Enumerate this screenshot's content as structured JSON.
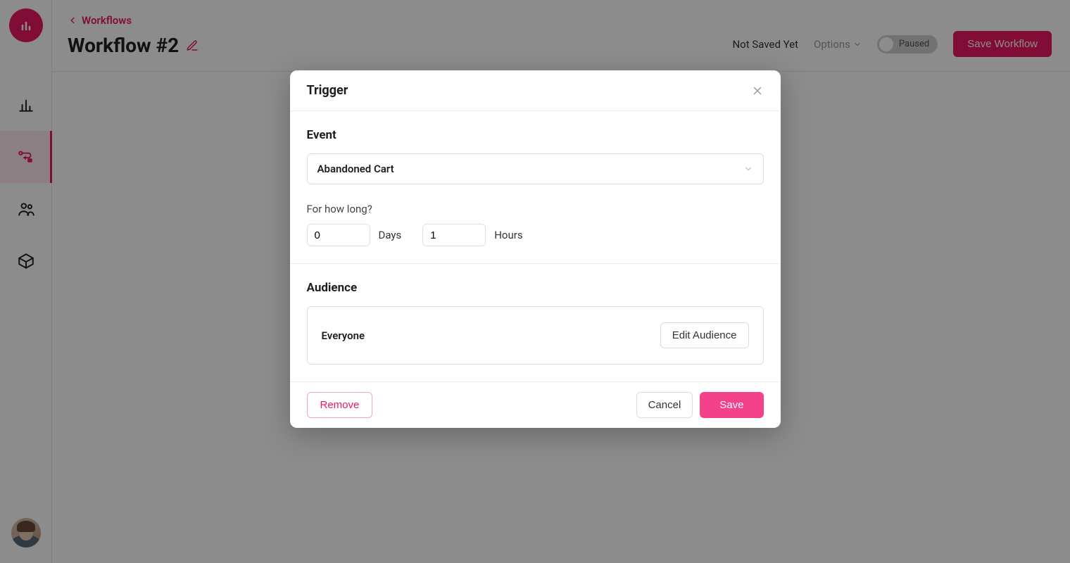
{
  "sidebar": {
    "items": [
      {
        "name": "analytics"
      },
      {
        "name": "workflows",
        "active": true
      },
      {
        "name": "people"
      },
      {
        "name": "products"
      }
    ]
  },
  "header": {
    "breadcrumb_label": "Workflows",
    "title": "Workflow #2",
    "status_text": "Not Saved Yet",
    "options_label": "Options",
    "toggle_label": "Paused",
    "save_label": "Save Workflow"
  },
  "modal": {
    "title": "Trigger",
    "event": {
      "section_title": "Event",
      "selected": "Abandoned Cart",
      "question": "For how long?",
      "days_value": "0",
      "days_unit": "Days",
      "hours_value": "1",
      "hours_unit": "Hours"
    },
    "audience": {
      "section_title": "Audience",
      "name": "Everyone",
      "edit_label": "Edit Audience"
    },
    "footer": {
      "remove_label": "Remove",
      "cancel_label": "Cancel",
      "save_label": "Save"
    }
  }
}
